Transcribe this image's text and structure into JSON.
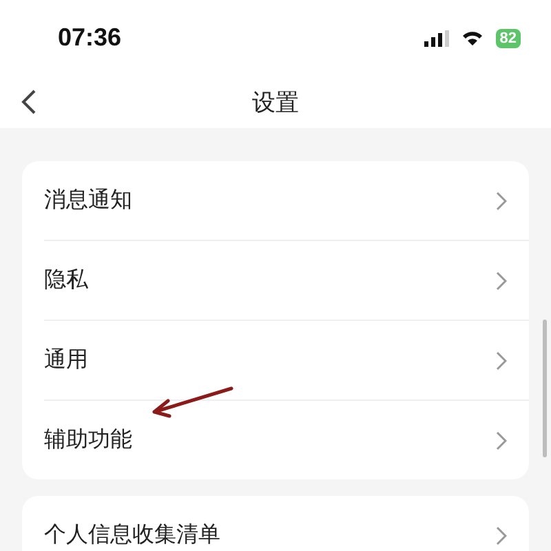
{
  "status_bar": {
    "time": "07:36",
    "battery": "82"
  },
  "nav": {
    "title": "设置"
  },
  "groups": [
    {
      "items": [
        {
          "label": "消息通知"
        },
        {
          "label": "隐私"
        },
        {
          "label": "通用"
        },
        {
          "label": "辅助功能"
        }
      ]
    },
    {
      "items": [
        {
          "label": "个人信息收集清单"
        }
      ]
    }
  ]
}
